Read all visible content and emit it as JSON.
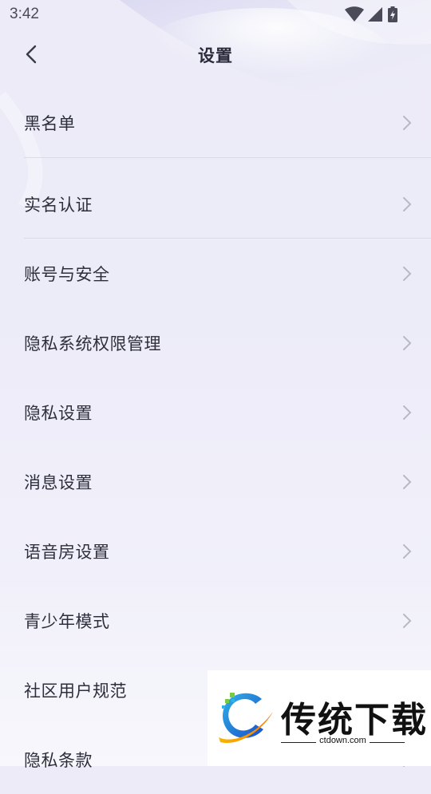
{
  "status_bar": {
    "time": "3:42",
    "icons": [
      "wifi-icon",
      "cellular-signal-icon",
      "battery-charging-icon"
    ]
  },
  "header": {
    "title": "设置",
    "back_icon": "chevron-left-icon"
  },
  "menu": {
    "items": [
      {
        "label": "黑名单",
        "icon": "chevron-right-icon"
      },
      {
        "label": "实名认证",
        "icon": "chevron-right-icon"
      },
      {
        "label": "账号与安全",
        "icon": "chevron-right-icon"
      },
      {
        "label": "隐私系统权限管理",
        "icon": "chevron-right-icon"
      },
      {
        "label": "隐私设置",
        "icon": "chevron-right-icon"
      },
      {
        "label": "消息设置",
        "icon": "chevron-right-icon"
      },
      {
        "label": "语音房设置",
        "icon": "chevron-right-icon"
      },
      {
        "label": "青少年模式",
        "icon": "chevron-right-icon"
      },
      {
        "label": "社区用户规范",
        "icon": "chevron-right-icon"
      },
      {
        "label": "隐私条款",
        "icon": "chevron-right-icon"
      }
    ]
  },
  "watermark": {
    "brand": "传统下载",
    "url": "ctdown.com"
  },
  "colors": {
    "background": "#ecebf7",
    "text": "#2e2e3c",
    "chevron": "#b8b8c4"
  }
}
